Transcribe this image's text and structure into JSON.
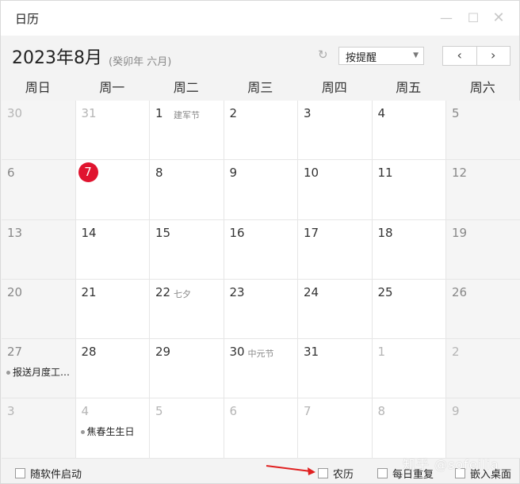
{
  "window": {
    "title": "日历"
  },
  "header": {
    "month_title": "2023年8月",
    "lunar": "(癸卯年 六月)",
    "reminder_select": "按提醒"
  },
  "weekdays": [
    "周日",
    "周一",
    "周二",
    "周三",
    "周四",
    "周五",
    "周六"
  ],
  "days": [
    {
      "d": "30",
      "other": true
    },
    {
      "d": "31",
      "other": true
    },
    {
      "d": "1",
      "festival": "建军节"
    },
    {
      "d": "2"
    },
    {
      "d": "3"
    },
    {
      "d": "4"
    },
    {
      "d": "5"
    },
    {
      "d": "6"
    },
    {
      "d": "7",
      "today": true
    },
    {
      "d": "8"
    },
    {
      "d": "9"
    },
    {
      "d": "10"
    },
    {
      "d": "11"
    },
    {
      "d": "12"
    },
    {
      "d": "13"
    },
    {
      "d": "14"
    },
    {
      "d": "15"
    },
    {
      "d": "16"
    },
    {
      "d": "17"
    },
    {
      "d": "18"
    },
    {
      "d": "19"
    },
    {
      "d": "20"
    },
    {
      "d": "21"
    },
    {
      "d": "22",
      "festival": "七夕"
    },
    {
      "d": "23"
    },
    {
      "d": "24"
    },
    {
      "d": "25"
    },
    {
      "d": "26"
    },
    {
      "d": "27",
      "event": "报送月度工…"
    },
    {
      "d": "28"
    },
    {
      "d": "29"
    },
    {
      "d": "30",
      "festival": "中元节"
    },
    {
      "d": "31"
    },
    {
      "d": "1",
      "other": true
    },
    {
      "d": "2",
      "other": true
    },
    {
      "d": "3",
      "other": true
    },
    {
      "d": "4",
      "other": true,
      "event": "焦春生生日"
    },
    {
      "d": "5",
      "other": true
    },
    {
      "d": "6",
      "other": true
    },
    {
      "d": "7",
      "other": true
    },
    {
      "d": "8",
      "other": true
    },
    {
      "d": "9",
      "other": true
    }
  ],
  "footer": {
    "autostart": "随软件启动",
    "lunar": "农历",
    "daily_repeat": "每日重复",
    "embed_desktop": "嵌入桌面"
  },
  "watermark": "知乎 @sofeilia",
  "colors": {
    "today": "#e0142f",
    "arrow": "#e02020"
  }
}
